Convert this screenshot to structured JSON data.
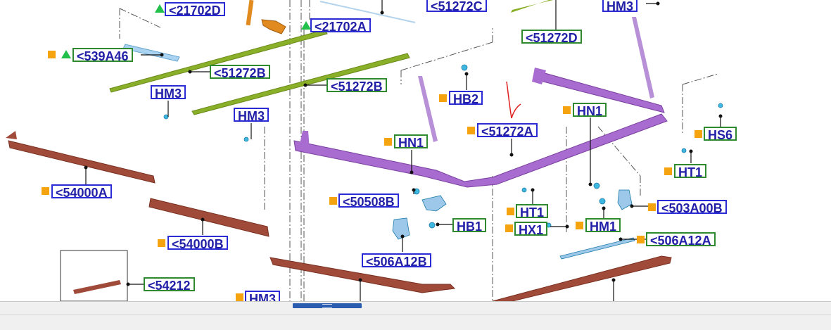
{
  "callouts": [
    {
      "text": "<21702D",
      "style": "blue"
    },
    {
      "text": "<21702A",
      "style": "blue"
    },
    {
      "text": "<51272C",
      "style": "blue"
    },
    {
      "text": "HM3",
      "style": "blue"
    },
    {
      "text": "<539A46",
      "style": "green"
    },
    {
      "text": "<51272B",
      "style": "green"
    },
    {
      "text": "<51272D",
      "style": "green"
    },
    {
      "text": "HM3",
      "style": "blue"
    },
    {
      "text": "<51272B",
      "style": "green"
    },
    {
      "text": "HB2",
      "style": "blue"
    },
    {
      "text": "HM3",
      "style": "blue"
    },
    {
      "text": "HN1",
      "style": "green"
    },
    {
      "text": "<51272A",
      "style": "blue"
    },
    {
      "text": "HS6",
      "style": "green"
    },
    {
      "text": "HN1",
      "style": "green"
    },
    {
      "text": "HT1",
      "style": "green"
    },
    {
      "text": "<54000A",
      "style": "blue"
    },
    {
      "text": "<50508B",
      "style": "blue"
    },
    {
      "text": "<503A00B",
      "style": "blue"
    },
    {
      "text": "HT1",
      "style": "green"
    },
    {
      "text": "HB1",
      "style": "green"
    },
    {
      "text": "HX1",
      "style": "green"
    },
    {
      "text": "HM1",
      "style": "green"
    },
    {
      "text": "<54000B",
      "style": "blue"
    },
    {
      "text": "<506A12A",
      "style": "green"
    },
    {
      "text": "<506A12B",
      "style": "blue"
    },
    {
      "text": "<54212",
      "style": "green"
    },
    {
      "text": "HM3",
      "style": "blue"
    }
  ],
  "colors": {
    "callout_border_blue": "#2b2bd6",
    "callout_border_green": "#2f8a2f",
    "callout_text": "#2320a8",
    "marker_square": "#f5a30f",
    "marker_triangle": "#21c04a",
    "part_purple": "#a86bd0",
    "part_brown": "#a04a3a",
    "part_green": "#8ab02a",
    "part_orange": "#e08a20",
    "part_lightblue": "#8ec5e8",
    "fastener_cyan": "#3fb8e0",
    "annotation_red": "#e02020",
    "scrollbar_thumb": "#2a5db0"
  },
  "icons": {
    "square_marker": "orange-square-icon",
    "triangle_marker": "green-triangle-icon",
    "red_mark": "red-arrow-annotation-icon"
  }
}
